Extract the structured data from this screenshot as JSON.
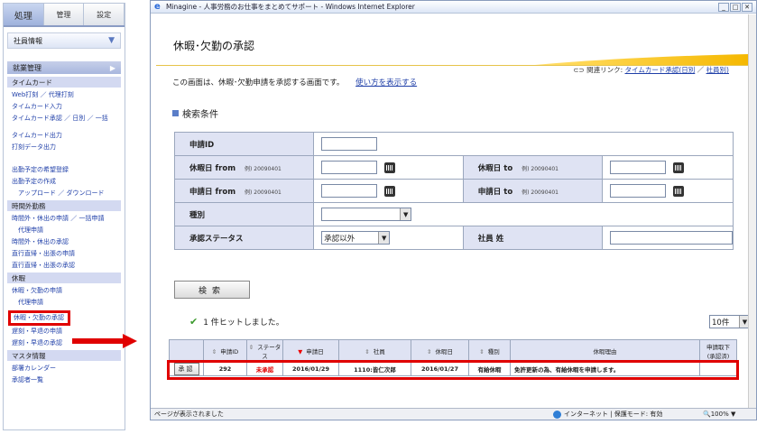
{
  "sidebar": {
    "tabs": [
      "処理",
      "管理",
      "設定"
    ],
    "company_dropdown": "社員情報",
    "module": "就業管理",
    "sections": [
      {
        "title": "タイムカード",
        "links": [
          "Web打刻 ／ 代理打刻",
          "タイムカード入力",
          "タイムカード承認 ／ 日別 ／ 一括",
          "タイムカード出力",
          "打刻データ出力"
        ]
      },
      {
        "title": "",
        "links": [
          "出勤予定の希望登録",
          "出勤予定の作成"
        ],
        "sub": "アップロード ／ ダウンロード"
      },
      {
        "title": "時間外勤務",
        "links": [
          "時間外・休出の申請 ／ 一括申請"
        ],
        "sub": "代理申請",
        "links2": [
          "時間外・休出の承認",
          "直行直帰・出張の申請",
          "直行直帰・出張の承認"
        ]
      },
      {
        "title": "休暇",
        "links": [
          "休暇・欠勤の申請"
        ],
        "sub": "代理申請",
        "highlight": "休暇・欠勤の承認",
        "links2": [
          "遅刻・早退の申請",
          "遅刻・早退の承認"
        ]
      },
      {
        "title": "マスタ情報",
        "links": [
          "部署カレンダー",
          "承認者一覧"
        ]
      }
    ]
  },
  "browser": {
    "title": "Minagine - 人事労務のお仕事をまとめてサポート - Windows Internet Explorer",
    "page_title": "休暇･欠勤の承認",
    "related_label": "関連リンク:",
    "related_link1": "タイムカード承認(日別",
    "related_sep": "／",
    "related_link2": "社員別)",
    "description": "この画面は、休暇･欠勤申請を承認する画面です。",
    "help_link": "使い方を表示する",
    "search_heading": "検索条件",
    "search": {
      "apply_id": "申請ID",
      "leave_from": "休暇日 from",
      "leave_to": "休暇日 to",
      "apply_from": "申請日 from",
      "apply_to": "申請日 to",
      "hint": "例) 20090401",
      "type": "種別",
      "status": "承認ステータス",
      "status_value": "承認以外",
      "employee_last": "社員 姓"
    },
    "search_button": "検索",
    "hits": "1 件ヒットしました。",
    "per_page": "10件",
    "results": {
      "headers": [
        "",
        "申請ID",
        "ステータス",
        "申請日",
        "社員",
        "休暇日",
        "種別",
        "休暇理由",
        "申請取下\n(承認済)"
      ],
      "row": {
        "action": "承認",
        "id": "292",
        "status": "未承認",
        "apply_date": "2016/01/29",
        "employee": "1110:皆仁次郎",
        "leave_date": "2016/01/27",
        "type": "有給休暇",
        "reason": "免許更新の為、有給休暇を申請します。"
      }
    },
    "status_left": "ページが表示されました",
    "status_zone": "インターネット | 保護モード: 有効",
    "zoom": "100%"
  }
}
